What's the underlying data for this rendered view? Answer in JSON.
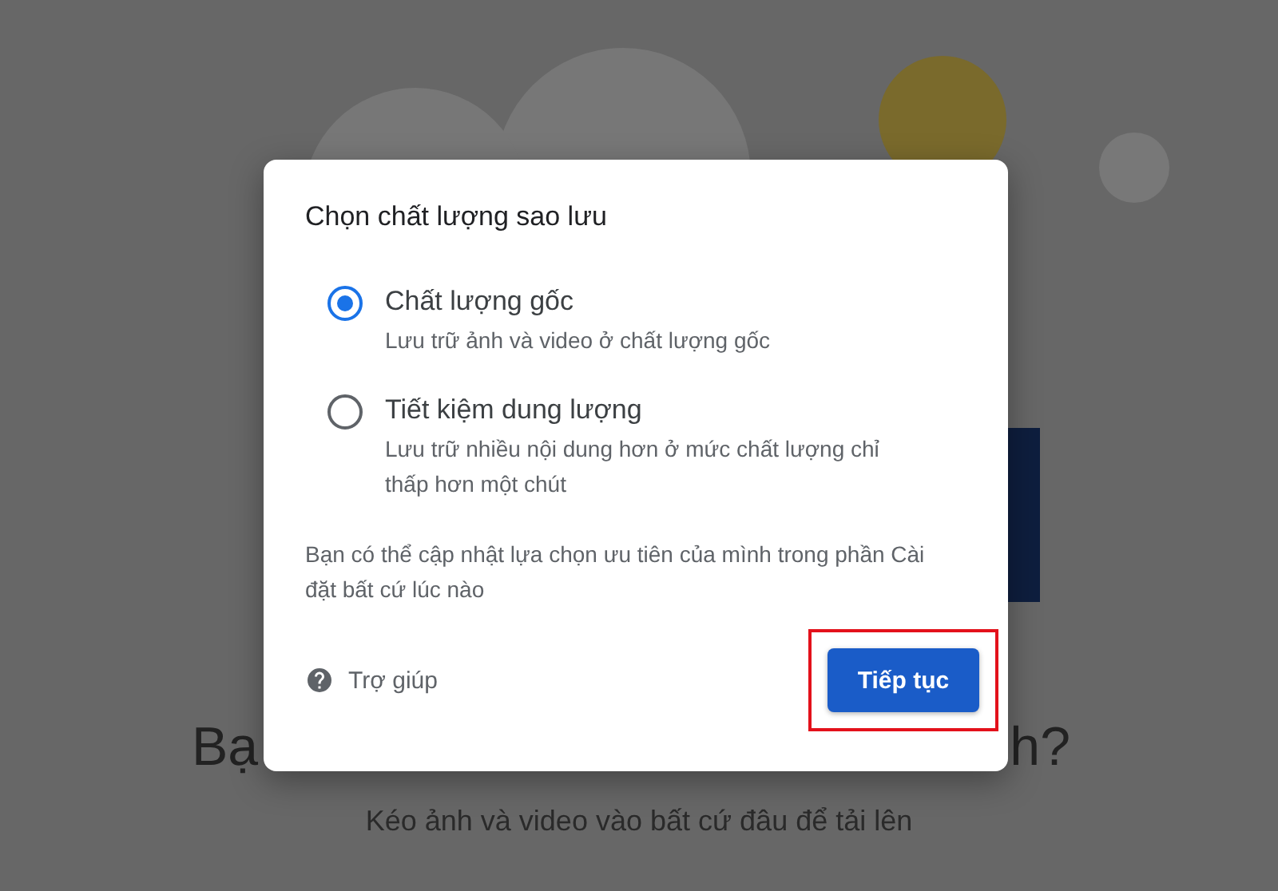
{
  "page": {
    "heading_left": "Bạ",
    "heading_right": "h?",
    "subtitle": "Kéo ảnh và video vào bất cứ đâu để tải lên"
  },
  "dialog": {
    "title": "Chọn chất lượng sao lưu",
    "options": [
      {
        "label": "Chất lượng gốc",
        "description": "Lưu trữ ảnh và video ở chất lượng gốc",
        "selected": true
      },
      {
        "label": "Tiết kiệm dung lượng",
        "description": "Lưu trữ nhiều nội dung hơn ở mức chất lượng chỉ thấp hơn một chút",
        "selected": false
      }
    ],
    "note": "Bạn có thể cập nhật lựa chọn ưu tiên của mình trong phần Cài đặt bất cứ lúc nào",
    "help_link": "Trợ giúp",
    "continue_button": "Tiếp tục"
  }
}
